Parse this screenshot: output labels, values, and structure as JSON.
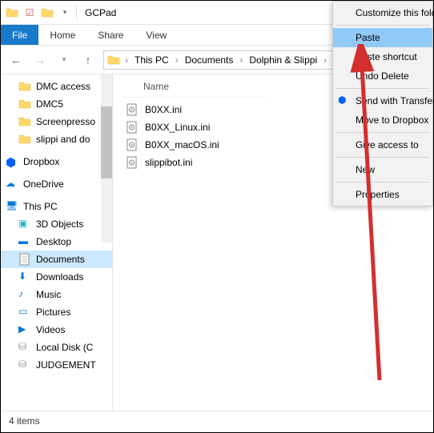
{
  "title": "GCPad",
  "ribbon": {
    "file": "File",
    "home": "Home",
    "share": "Share",
    "view": "View"
  },
  "breadcrumb": [
    "This PC",
    "Documents",
    "Dolphin & Slippi"
  ],
  "columns": {
    "name": "Name"
  },
  "sidebar": {
    "quick": [
      "DMC access",
      "DMC5",
      "Screenpresso",
      "slippi and do"
    ],
    "dropbox": "Dropbox",
    "onedrive": "OneDrive",
    "thispc": "This PC",
    "pc_items": [
      "3D Objects",
      "Desktop",
      "Documents",
      "Downloads",
      "Music",
      "Pictures",
      "Videos",
      "Local Disk (C",
      "JUDGEMENT"
    ]
  },
  "files": [
    "B0XX.ini",
    "B0XX_Linux.ini",
    "B0XX_macOS.ini",
    "slippibot.ini"
  ],
  "status": "4 items",
  "ctx": {
    "customize": "Customize this fold",
    "paste": "Paste",
    "paste_shortcut": "Paste shortcut",
    "undo_delete": "Undo Delete",
    "send_transfer": "Send with Transfer.",
    "move_dropbox": "Move to Dropbox",
    "give_access": "Give access to",
    "new": "New",
    "properties": "Properties"
  }
}
